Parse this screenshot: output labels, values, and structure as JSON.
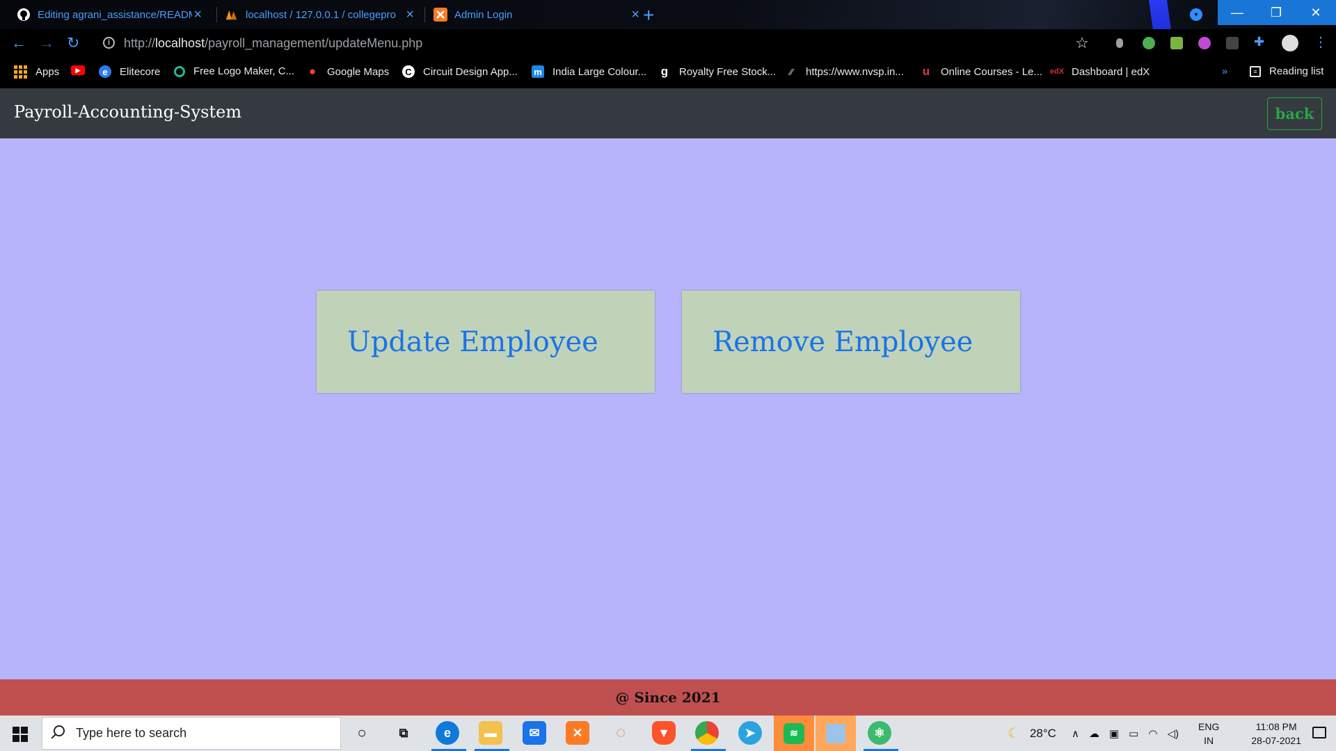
{
  "browser": {
    "tabs": [
      {
        "title": "Editing agrani_assistance/READM",
        "icon": "github-icon"
      },
      {
        "title": "localhost / 127.0.0.1 / collegepro",
        "icon": "phpmyadmin-icon"
      },
      {
        "title": "Admin Login",
        "icon": "xampp-icon"
      }
    ],
    "close_glyph": "×",
    "new_tab_glyph": "+",
    "url_prefix": "http://",
    "url_host": "localhost",
    "url_path": "/payroll_management/updateMenu.php",
    "bookmarks": [
      {
        "label": "Apps",
        "icon": "apps-grid-icon"
      },
      {
        "label": "",
        "icon": "youtube-icon"
      },
      {
        "label": "Elitecore",
        "icon": "elitecore-icon"
      },
      {
        "label": "Free Logo Maker, C...",
        "icon": "logo-maker-icon"
      },
      {
        "label": "Google Maps",
        "icon": "google-maps-icon"
      },
      {
        "label": "Circuit Design App...",
        "icon": "circuit-icon"
      },
      {
        "label": "India Large Colour...",
        "icon": "map-icon"
      },
      {
        "label": "Royalty Free Stock...",
        "icon": "stock-icon"
      },
      {
        "label": "https://www.nvsp.in...",
        "icon": "nvsp-icon"
      },
      {
        "label": "Online Courses - Le...",
        "icon": "udemy-icon"
      },
      {
        "label": "Dashboard | edX",
        "icon": "edx-icon"
      }
    ],
    "bookmarks_overflow": "»",
    "reading_list": "Reading list"
  },
  "page": {
    "brand": "Payroll-Accounting-System",
    "back_label": "back",
    "cards": [
      {
        "label": "Update Employee"
      },
      {
        "label": "Remove Employee"
      }
    ],
    "footer": "@ Since 2021"
  },
  "taskbar": {
    "search_placeholder": "Type here to search",
    "weather": "28°C",
    "lang_line1": "ENG",
    "lang_line2": "IN",
    "time": "11:08 PM",
    "date": "28-07-2021"
  },
  "colors": {
    "page_bg": "#b8b4fb",
    "navbar_bg": "#343a40",
    "card_bg": "#c0d3b9",
    "card_text": "#1a73e8",
    "back_green": "#28a745",
    "footer_bg": "#c05050"
  }
}
